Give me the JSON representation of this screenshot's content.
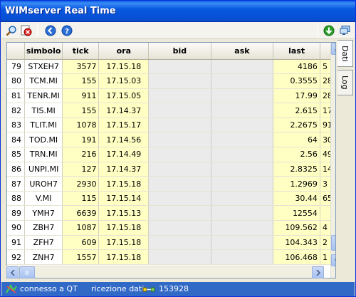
{
  "window": {
    "title": "WIMserver Real Time"
  },
  "toolbar": {
    "buttons": [
      "search-icon",
      "stop-icon",
      "back-icon",
      "help-icon",
      "download-icon",
      "monitor-icon"
    ]
  },
  "table": {
    "columns": [
      "",
      "simbolo",
      "tick",
      "ora",
      "bid",
      "ask",
      "last",
      ""
    ],
    "rows": [
      {
        "n": "79",
        "simbolo": "STXEH7",
        "tick": "3577",
        "ora": "17.15.18",
        "last": "4186",
        "extra": "5"
      },
      {
        "n": "80",
        "simbolo": "TCM.MI",
        "tick": "155",
        "ora": "17.15.03",
        "last": "0.3555",
        "extra": "28"
      },
      {
        "n": "81",
        "simbolo": "TENR.MI",
        "tick": "911",
        "ora": "17.15.05",
        "last": "17.99",
        "extra": "28"
      },
      {
        "n": "82",
        "simbolo": "TIS.MI",
        "tick": "155",
        "ora": "17.14.37",
        "last": "2.615",
        "extra": "17"
      },
      {
        "n": "83",
        "simbolo": "TLIT.MI",
        "tick": "1078",
        "ora": "17.15.17",
        "last": "2.2675",
        "extra": "91"
      },
      {
        "n": "84",
        "simbolo": "TOD.MI",
        "tick": "191",
        "ora": "17.14.56",
        "last": "64",
        "extra": "30"
      },
      {
        "n": "85",
        "simbolo": "TRN.MI",
        "tick": "216",
        "ora": "17.14.49",
        "last": "2.56",
        "extra": "49"
      },
      {
        "n": "86",
        "simbolo": "UNPI.MI",
        "tick": "127",
        "ora": "17.14.37",
        "last": "2.8325",
        "extra": "14"
      },
      {
        "n": "87",
        "simbolo": "UROH7",
        "tick": "2930",
        "ora": "17.15.18",
        "last": "1.2969",
        "extra": "3"
      },
      {
        "n": "88",
        "simbolo": "V.MI",
        "tick": "115",
        "ora": "17.15.14",
        "last": "30.44",
        "extra": "65"
      },
      {
        "n": "89",
        "simbolo": "YMH7",
        "tick": "6639",
        "ora": "17.15.13",
        "last": "12554",
        "extra": ""
      },
      {
        "n": "90",
        "simbolo": "ZBH7",
        "tick": "1087",
        "ora": "17.15.18",
        "last": "109.562",
        "extra": "4"
      },
      {
        "n": "91",
        "simbolo": "ZFH7",
        "tick": "609",
        "ora": "17.15.18",
        "last": "104.343",
        "extra": "2"
      },
      {
        "n": "92",
        "simbolo": "ZNH7",
        "tick": "1557",
        "ora": "17.15.18",
        "last": "106.468",
        "extra": "1"
      }
    ]
  },
  "tabs": [
    "Dati",
    "Log"
  ],
  "status": {
    "connection": "connesso a QT",
    "receiving": "ricezione dati",
    "count": "153928"
  },
  "colors": {
    "title": "#0a5ee8",
    "status": "#3169c6",
    "highlight": "#ffffc4"
  }
}
